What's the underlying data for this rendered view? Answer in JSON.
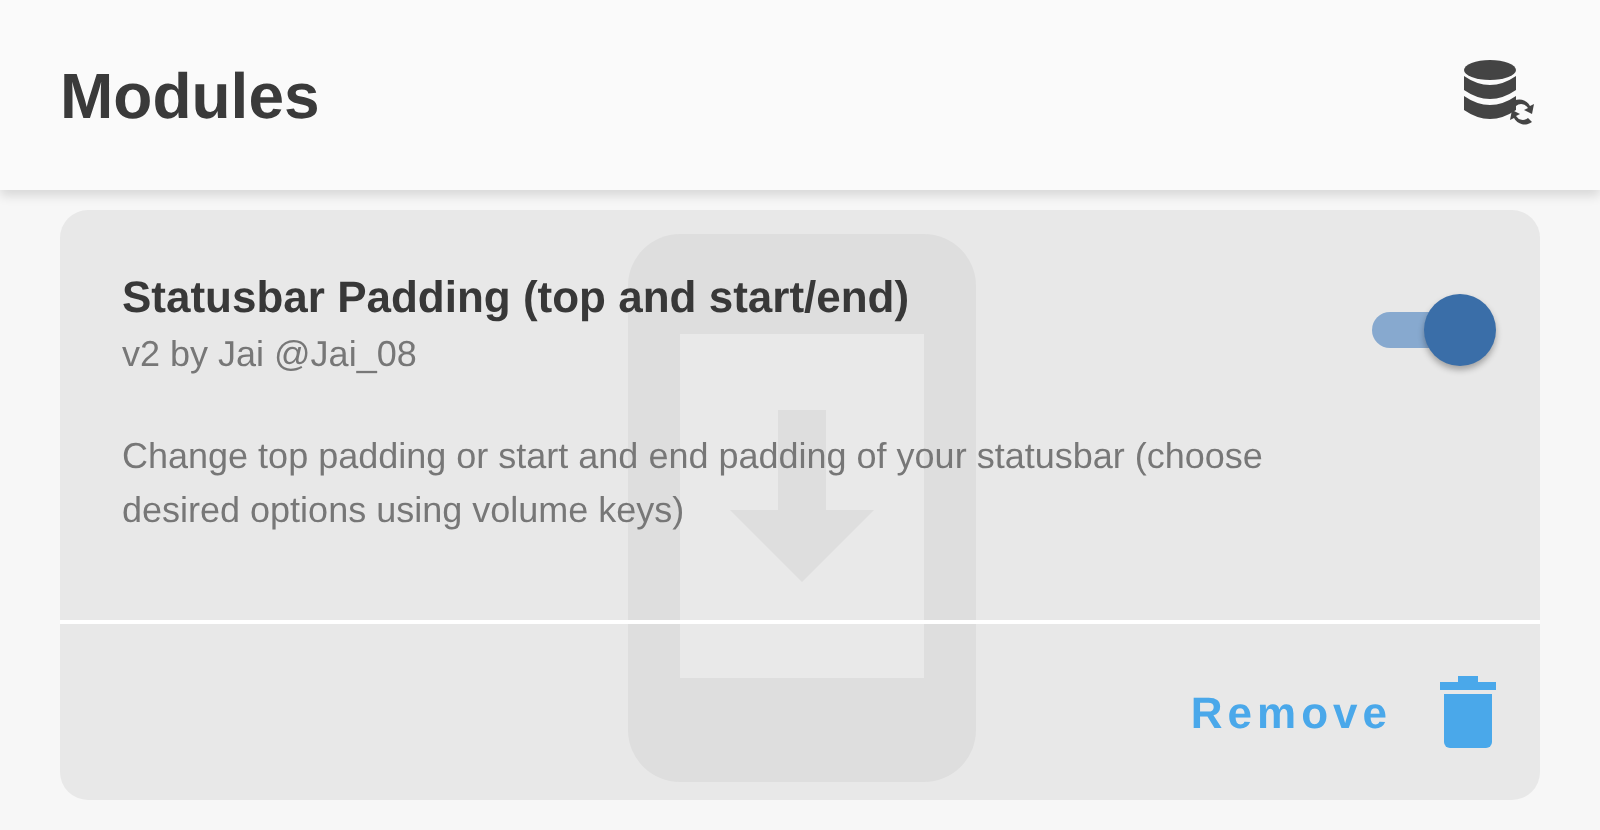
{
  "app_bar": {
    "title": "Modules"
  },
  "modules": [
    {
      "name": "Statusbar Padding (top and start/end)",
      "author_line": "v2 by Jai @Jai_08",
      "description": "Change top padding or start and end padding of your statusbar (choose desired options using volume keys)",
      "enabled": true,
      "remove_label": "Remove"
    }
  ]
}
